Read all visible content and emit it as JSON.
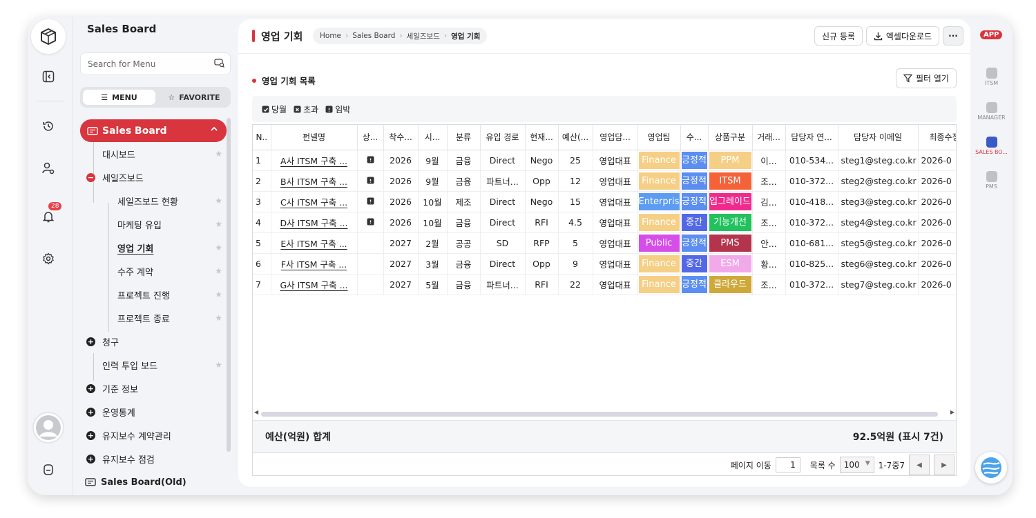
{
  "sidebar": {
    "title": "Sales Board",
    "search_placeholder": "Search for Menu",
    "tab_menu": "MENU",
    "tab_favorite": "FAVORITE",
    "active_group": "Sales Board",
    "items": {
      "dashboard": "대시보드",
      "sales_board_group": "세일즈보드",
      "sales_status": "세일즈보드 현황",
      "marketing": "마케팅 유입",
      "opportunity": "영업 기회",
      "contract": "수주 계약",
      "project_progress": "프로젝트 진행",
      "project_end": "프로젝트 종료",
      "billing": "청구",
      "manpower": "인력 투입 보드",
      "master": "기준 정보",
      "stats": "운영통계",
      "maint_contract": "유지보수 계약관리",
      "maint_check": "유지보수 점검",
      "old_board": "Sales Board(Old)"
    }
  },
  "rail": {
    "notification_count": "28"
  },
  "header": {
    "title": "영업 기회",
    "breadcrumb": [
      "Home",
      "Sales Board",
      "세일즈보드",
      "영업 기회"
    ],
    "new_button": "신규 등록",
    "excel_button": "엑셀다운로드",
    "more_button": "···"
  },
  "section": {
    "title": "영업 기회 목록",
    "filter_button": "필터 열기",
    "legend": [
      "당월",
      "초과",
      "임박"
    ]
  },
  "table": {
    "columns": [
      "N..",
      "펀넬명",
      "상...",
      "착수...",
      "시...",
      "분류",
      "유입 경로",
      "현재...",
      "예산(...",
      "영업담...",
      "영업팀",
      "수...",
      "상품구분",
      "거래...",
      "담당자 연...",
      "담당자 이메일",
      "최종수정"
    ],
    "rows": [
      {
        "no": "1",
        "name": "A사 ITSM 구축 ...",
        "flag": true,
        "year": "2026",
        "month": "9월",
        "cat": "금융",
        "source": "Direct",
        "status": "Nego",
        "budget": "25",
        "rep": "영업대표",
        "team": "Finance",
        "team_color": "#f5cf85",
        "level": "긍정적",
        "level_color": "#5b8ef0",
        "product": "PPM",
        "product_color": "#f5cf85",
        "client": "이...",
        "phone": "010-534...",
        "email": "steg1@steg.co.kr",
        "modified": "2026-0"
      },
      {
        "no": "2",
        "name": "B사 ITSM 구축 ...",
        "flag": true,
        "year": "2026",
        "month": "9월",
        "cat": "금융",
        "source": "파트너...",
        "status": "Opp",
        "budget": "12",
        "rep": "영업대표",
        "team": "Finance",
        "team_color": "#f5cf85",
        "level": "긍정적",
        "level_color": "#5b8ef0",
        "product": "ITSM",
        "product_color": "#f5623a",
        "client": "조...",
        "phone": "010-372...",
        "email": "steg2@steg.co.kr",
        "modified": "2026-0"
      },
      {
        "no": "3",
        "name": "C사 ITSM 구축 ...",
        "flag": true,
        "year": "2026",
        "month": "10월",
        "cat": "제조",
        "source": "Direct",
        "status": "Nego",
        "budget": "15",
        "rep": "영업대표",
        "team": "Enterprise",
        "team_color": "#5c9cf2",
        "level": "긍정적",
        "level_color": "#5b8ef0",
        "product": "업그레이드",
        "product_color": "#ee2b8c",
        "client": "김...",
        "phone": "010-418...",
        "email": "steg3@steg.co.kr",
        "modified": "2026-0"
      },
      {
        "no": "4",
        "name": "D사 ITSM 구축 ...",
        "flag": true,
        "year": "2026",
        "month": "10월",
        "cat": "금융",
        "source": "Direct",
        "status": "RFI",
        "budget": "4.5",
        "rep": "영업대표",
        "team": "Finance",
        "team_color": "#f5cf85",
        "level": "중간",
        "level_color": "#5368e6",
        "product": "기능개선",
        "product_color": "#22c15e",
        "client": "조...",
        "phone": "010-372...",
        "email": "steg4@steg.co.kr",
        "modified": "2026-0"
      },
      {
        "no": "5",
        "name": "E사 ITSM 구축 ...",
        "flag": false,
        "year": "2027",
        "month": "2월",
        "cat": "공공",
        "source": "SD",
        "status": "RFP",
        "budget": "5",
        "rep": "영업대표",
        "team": "Public",
        "team_color": "#d64ee8",
        "level": "긍정적",
        "level_color": "#5b8ef0",
        "product": "PMS",
        "product_color": "#b3344c",
        "client": "안...",
        "phone": "010-681...",
        "email": "steg5@steg.co.kr",
        "modified": "2026-0"
      },
      {
        "no": "6",
        "name": "F사 ITSM 구축 ...",
        "flag": false,
        "year": "2027",
        "month": "3월",
        "cat": "금융",
        "source": "Direct",
        "status": "Opp",
        "budget": "9",
        "rep": "영업대표",
        "team": "Finance",
        "team_color": "#f5cf85",
        "level": "중간",
        "level_color": "#5368e6",
        "product": "ESM",
        "product_color": "#f2a9ea",
        "client": "황...",
        "phone": "010-825...",
        "email": "steg6@steg.co.kr",
        "modified": "2026-0"
      },
      {
        "no": "7",
        "name": "G사 ITSM 구축 ...",
        "flag": false,
        "year": "2027",
        "month": "5월",
        "cat": "금융",
        "source": "파트너...",
        "status": "RFI",
        "budget": "22",
        "rep": "영업대표",
        "team": "Finance",
        "team_color": "#f5cf85",
        "level": "긍정적",
        "level_color": "#5b8ef0",
        "product": "클라우드",
        "product_color": "#cfa83a",
        "client": "조...",
        "phone": "010-372...",
        "email": "steg7@steg.co.kr",
        "modified": "2026-0"
      }
    ],
    "summary_label": "예산(억원) 합계",
    "summary_value": "92.5억원 (표시 7건)"
  },
  "pager": {
    "goto_label": "페이지 이동",
    "page": "1",
    "rows_label": "목록 수",
    "rows_value": "100",
    "range": "1-7중7"
  },
  "right_rail": {
    "app_badge": "APP",
    "items": [
      "ITSM",
      "MANAGER",
      "SALES BO...",
      "PMS"
    ]
  }
}
